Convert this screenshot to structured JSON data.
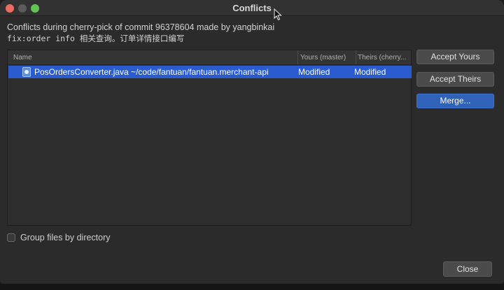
{
  "window": {
    "title": "Conflicts"
  },
  "message": {
    "line1": "Conflicts during cherry-pick of commit 96378604 made by yangbinkai",
    "line2": "fix:order info 相关查询。订单详情接口编写"
  },
  "table": {
    "headers": {
      "name": "Name",
      "yours": "Yours (master)",
      "theirs": "Theirs (cherry..."
    },
    "rows": [
      {
        "name": "PosOrdersConverter.java  ~/code/fantuan/fantuan.merchant-api",
        "yours": "Modified",
        "theirs": "Modified",
        "icon": "java-file-icon"
      }
    ]
  },
  "buttons": {
    "accept_yours": "Accept Yours",
    "accept_theirs": "Accept Theirs",
    "merge": "Merge...",
    "close": "Close"
  },
  "options": {
    "group_by_directory": "Group files by directory",
    "group_by_directory_checked": false
  },
  "colors": {
    "selection": "#2b5ccf",
    "default_button": "#2f62b8",
    "background": "#2b2b2b"
  }
}
